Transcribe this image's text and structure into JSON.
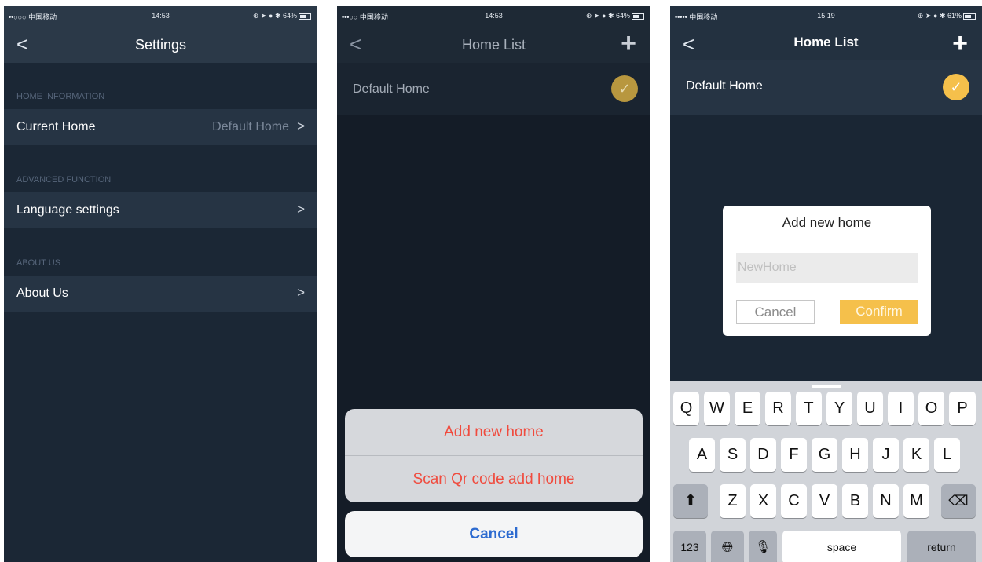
{
  "status_bars": [
    {
      "carrier": "••○○○ 中国移动 ",
      "time": "14:53",
      "battery": "64%"
    },
    {
      "carrier": "•••○○ 中国移动 ",
      "time": "14:53",
      "battery": "64%"
    },
    {
      "carrier": "••••• 中国移动 ",
      "time": "15:19",
      "battery": "61%"
    }
  ],
  "icons": {
    "back": "chevron-left-icon",
    "plus": "plus-icon",
    "check": "checkmark-circle-icon",
    "forward": "chevron-right-icon"
  },
  "colors": {
    "accent": "#f5c04b",
    "destructive": "#f04b3e",
    "link": "#2d6bd0",
    "navbar": "#2b3948"
  },
  "settings": {
    "title": "Settings",
    "sections": [
      {
        "header": "HOME INFORMATION",
        "label": "Current Home",
        "value": "Default Home"
      },
      {
        "header": "ADVANCED FUNCTION",
        "label": "Language settings"
      },
      {
        "header": "ABOUT US",
        "label": "About Us"
      }
    ]
  },
  "home_list": {
    "title": "Home List",
    "home_name": "Default Home",
    "sheet": {
      "add": "Add new home",
      "scan": "Scan Qr code add home",
      "cancel": "Cancel"
    }
  },
  "dialog": {
    "title": "Add new home",
    "placeholder": "NewHome",
    "cancel": "Cancel",
    "confirm": "Confirm"
  },
  "keyboard": {
    "row1": [
      "Q",
      "W",
      "E",
      "R",
      "T",
      "Y",
      "U",
      "I",
      "O",
      "P"
    ],
    "row2": [
      "A",
      "S",
      "D",
      "F",
      "G",
      "H",
      "J",
      "K",
      "L"
    ],
    "row3": [
      "Z",
      "X",
      "C",
      "V",
      "B",
      "N",
      "M"
    ],
    "numbers": "123",
    "space": "space",
    "return": "return"
  }
}
